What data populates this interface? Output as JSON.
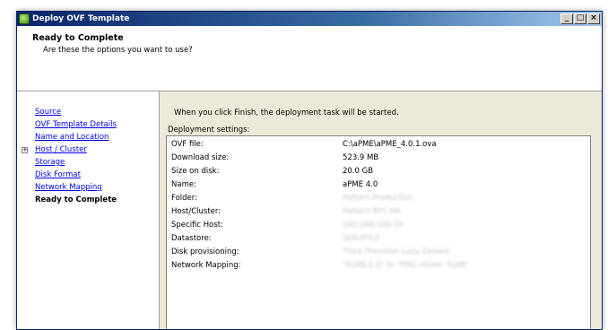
{
  "window": {
    "title": "Deploy OVF Template",
    "buttons": {
      "minimize": "_",
      "maximize": "□",
      "close": "×"
    }
  },
  "header": {
    "title": "Ready to Complete",
    "subtitle": "Are these the options you want to use?"
  },
  "nav": {
    "items": [
      {
        "label": "Source",
        "current": false,
        "expandable": false
      },
      {
        "label": "OVF Template Details",
        "current": false,
        "expandable": false
      },
      {
        "label": "Name and Location",
        "current": false,
        "expandable": false
      },
      {
        "label": "Host / Cluster",
        "current": false,
        "expandable": true
      },
      {
        "label": "Storage",
        "current": false,
        "expandable": false
      },
      {
        "label": "Disk Format",
        "current": false,
        "expandable": false
      },
      {
        "label": "Network Mapping",
        "current": false,
        "expandable": false
      },
      {
        "label": "Ready to Complete",
        "current": true,
        "expandable": false
      }
    ],
    "expander_symbol": "+"
  },
  "content": {
    "intro": "When you click Finish, the deployment task will be started.",
    "settings_label": "Deployment settings:",
    "settings": [
      {
        "key": "OVF file:",
        "value": "C:\\aPME\\aPME_4.0.1.ova"
      },
      {
        "key": "Download size:",
        "value": "523.9 MB"
      },
      {
        "key": "Size on disk:",
        "value": "20.0 GB"
      },
      {
        "key": "Name:",
        "value": "aPME 4.0"
      },
      {
        "key": "Folder:",
        "value": "Pattern Production",
        "blurred": true
      },
      {
        "key": "Host/Cluster:",
        "value": "Pattern RFC HA",
        "blurred": true
      },
      {
        "key": "Specific Host:",
        "value": "192.168.100.29",
        "blurred": true
      },
      {
        "key": "Datastore:",
        "value": "SER-VOL2",
        "blurred": true
      },
      {
        "key": "Disk provisioning:",
        "value": "Thick Provision Lazy Zeroed",
        "blurred": true
      },
      {
        "key": "Network Mapping:",
        "value": "\"EsXN-1.0\" to \"PRIC-Vision 7LAN\"",
        "blurred": true
      }
    ]
  }
}
